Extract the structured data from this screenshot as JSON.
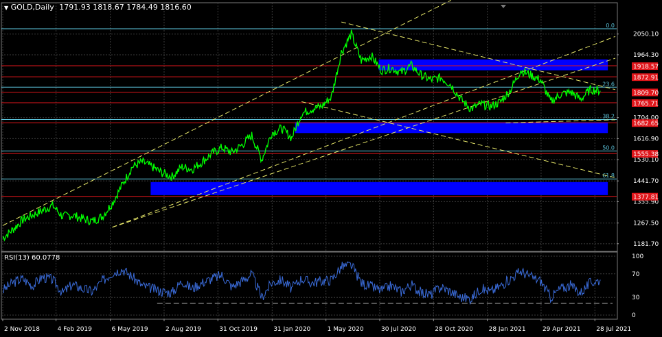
{
  "header": {
    "symbol": "GOLD,Daily",
    "ohlc": "1791.93 1818.67 1784.49 1816.60"
  },
  "chart_data": [
    {
      "type": "line",
      "title": "GOLD,Daily",
      "ylim": [
        1150,
        2140
      ],
      "y_ticks": [
        "2050.10",
        "1964.30",
        "1704.00",
        "1616.90",
        "1530.10",
        "1441.70",
        "1355.90",
        "1267.50",
        "1181.70"
      ],
      "y_tick_values": [
        2050.1,
        1964.3,
        1704.0,
        1616.9,
        1530.1,
        1441.7,
        1355.9,
        1267.5,
        1181.7
      ],
      "x_labels": [
        "2 Nov 2018",
        "4 Feb 2019",
        "6 May 2019",
        "2 Aug 2019",
        "31 Oct 2019",
        "31 Jan 2020",
        "1 May 2020",
        "30 Jul 2020",
        "28 Oct 2020",
        "28 Jan 2021",
        "29 Apr 2021",
        "28 Jul 2021"
      ],
      "x_label_pos": [
        0,
        0.107,
        0.216,
        0.324,
        0.432,
        0.541,
        0.649,
        0.757,
        0.865,
        0.973,
        1.081,
        1.189
      ],
      "series": [
        {
          "x": [
            0,
            0.02,
            0.04,
            0.06,
            0.08,
            0.1,
            0.12,
            0.14,
            0.16,
            0.18,
            0.2,
            0.22,
            0.24,
            0.26,
            0.28,
            0.3,
            0.32,
            0.34,
            0.36,
            0.38,
            0.4,
            0.42,
            0.44,
            0.46,
            0.48,
            0.5,
            0.52,
            0.54,
            0.56,
            0.58,
            0.6,
            0.62,
            0.64,
            0.66,
            0.68,
            0.7,
            0.72,
            0.74,
            0.76,
            0.78,
            0.8,
            0.82,
            0.84,
            0.86,
            0.88,
            0.9,
            0.92,
            0.94,
            0.96,
            0.98,
            1.0,
            1.02,
            1.04,
            1.06,
            1.08,
            1.1,
            1.12,
            1.14,
            1.16,
            1.18,
            1.2
          ],
          "y": [
            1205,
            1240,
            1280,
            1300,
            1320,
            1340,
            1295,
            1300,
            1285,
            1275,
            1295,
            1350,
            1425,
            1500,
            1520,
            1500,
            1475,
            1460,
            1500,
            1490,
            1520,
            1555,
            1580,
            1560,
            1590,
            1630,
            1530,
            1640,
            1660,
            1620,
            1720,
            1740,
            1750,
            1790,
            1975,
            2050,
            1940,
            1960,
            1900,
            1910,
            1890,
            1920,
            1880,
            1860,
            1870,
            1840,
            1780,
            1740,
            1760,
            1750,
            1770,
            1820,
            1900,
            1880,
            1860,
            1770,
            1800,
            1810,
            1780,
            1820,
            1815
          ]
        }
      ],
      "levels": [
        {
          "label": "1918.57",
          "value": 1918.57,
          "kind": "red"
        },
        {
          "label": "1872.91",
          "value": 1872.91,
          "kind": "red"
        },
        {
          "label": "1809.70",
          "value": 1809.7,
          "kind": "red"
        },
        {
          "label": "1765.71",
          "value": 1765.71,
          "kind": "red"
        },
        {
          "label": "1682.65",
          "value": 1682.65,
          "kind": "red"
        },
        {
          "label": "1555.38",
          "value": 1555.38,
          "kind": "red"
        },
        {
          "label": "1377.81",
          "value": 1377.81,
          "kind": "red"
        }
      ],
      "fibonacci": [
        {
          "label": "0.0",
          "value": 2072
        },
        {
          "label": "23.6",
          "value": 1830
        },
        {
          "label": "38.2",
          "value": 1696
        },
        {
          "label": "50.0",
          "value": 1566
        },
        {
          "label": "61.8",
          "value": 1450
        }
      ],
      "zones": [
        {
          "x": [
            0.755,
            1.215
          ],
          "y": [
            1900,
            1945
          ]
        },
        {
          "x": [
            0.587,
            1.215
          ],
          "y": [
            1640,
            1685
          ]
        },
        {
          "x": [
            0.297,
            1.215
          ],
          "y": [
            1383,
            1437
          ]
        }
      ],
      "trendlines": [
        {
          "x": [
            0.0,
            0.9
          ],
          "y": [
            1257,
            2190
          ]
        },
        {
          "x": [
            0.22,
            1.23
          ],
          "y": [
            1250,
            2040
          ]
        },
        {
          "x": [
            0.22,
            1.23
          ],
          "y": [
            1250,
            1950
          ]
        },
        {
          "x": [
            0.68,
            1.23
          ],
          "y": [
            2100,
            1820
          ]
        },
        {
          "x": [
            0.6,
            1.23
          ],
          "y": [
            1770,
            1455
          ]
        },
        {
          "x": [
            1.01,
            1.23
          ],
          "y": [
            1682,
            1695
          ]
        }
      ],
      "price_labels": {
        "fib": "#5ec8e0"
      }
    },
    {
      "type": "line",
      "title": "RSI(13) 60.0778",
      "ylim": [
        0,
        100
      ],
      "y_ticks": [
        "100",
        "70",
        "30",
        "0"
      ],
      "y_tick_values": [
        100,
        70,
        30,
        0
      ],
      "levels": [
        {
          "value": 20,
          "label": ""
        }
      ],
      "series": [
        {
          "x": [
            0,
            0.02,
            0.04,
            0.06,
            0.08,
            0.1,
            0.12,
            0.14,
            0.16,
            0.18,
            0.2,
            0.22,
            0.24,
            0.26,
            0.28,
            0.3,
            0.32,
            0.34,
            0.36,
            0.38,
            0.4,
            0.42,
            0.44,
            0.46,
            0.48,
            0.5,
            0.52,
            0.54,
            0.56,
            0.58,
            0.6,
            0.62,
            0.64,
            0.66,
            0.68,
            0.7,
            0.72,
            0.74,
            0.76,
            0.78,
            0.8,
            0.82,
            0.84,
            0.86,
            0.88,
            0.9,
            0.92,
            0.94,
            0.96,
            0.98,
            1.0,
            1.02,
            1.04,
            1.06,
            1.08,
            1.1,
            1.12,
            1.14,
            1.16,
            1.18,
            1.2
          ],
          "y": [
            42,
            55,
            62,
            50,
            65,
            60,
            38,
            52,
            45,
            40,
            58,
            72,
            78,
            65,
            50,
            45,
            40,
            38,
            58,
            45,
            55,
            62,
            68,
            48,
            58,
            70,
            30,
            55,
            60,
            45,
            62,
            55,
            58,
            60,
            82,
            85,
            55,
            48,
            42,
            50,
            40,
            52,
            38,
            35,
            48,
            40,
            30,
            28,
            45,
            40,
            50,
            62,
            75,
            65,
            58,
            30,
            45,
            50,
            38,
            55,
            60
          ]
        }
      ]
    }
  ],
  "colors": {
    "price_line": "#00ff00",
    "rsi_line": "#3a6bd8",
    "level_red": "#e0161b",
    "zone": "#0000ff",
    "trend": "#e8e86a",
    "grid": "#3c3c3c"
  }
}
